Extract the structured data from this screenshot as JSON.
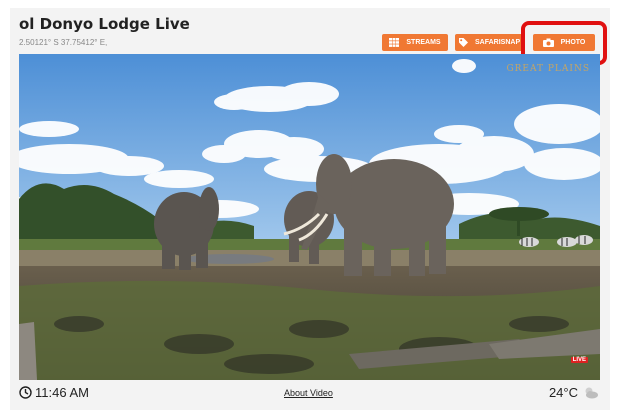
{
  "header": {
    "title": "ol Donyo Lodge Live",
    "coordinates": "2.50121° S   37.75412° E,"
  },
  "toolbar": {
    "streams_label": "STREAMS",
    "safarisnap_label": "SAFARISNAP",
    "photo_label": "PHOTO",
    "accent_color": "#f07833",
    "highlight_color": "#e01010"
  },
  "video": {
    "watermark": "GREAT PLAINS",
    "live_badge": "LIVE"
  },
  "footer": {
    "time": "11:46 AM",
    "about_link": "About Video",
    "temperature": "24°C",
    "weather_icon": "partly-cloudy-icon"
  }
}
